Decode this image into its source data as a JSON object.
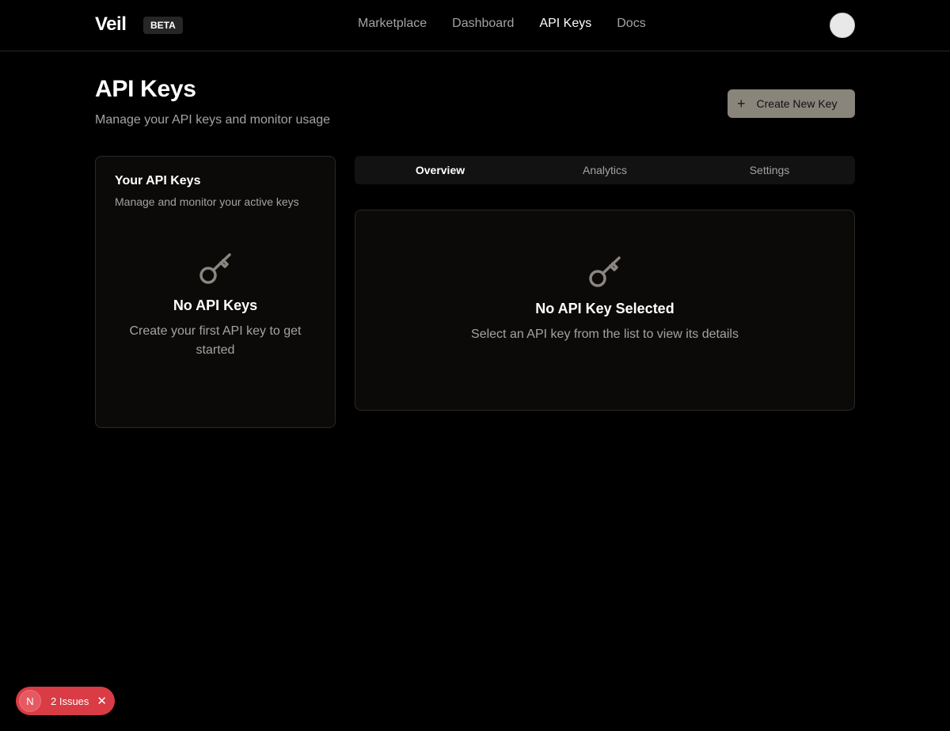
{
  "header": {
    "logo": "Veil",
    "badge": "BETA",
    "nav": [
      {
        "label": "Marketplace"
      },
      {
        "label": "Dashboard"
      },
      {
        "label": "API Keys"
      },
      {
        "label": "Docs"
      }
    ],
    "active_nav": "API Keys"
  },
  "page": {
    "title": "API Keys",
    "subtitle": "Manage your API keys and monitor usage",
    "create_button": "Create New Key",
    "create_icon": "plus-icon"
  },
  "keys_panel": {
    "title": "Your API Keys",
    "subtitle": "Manage and monitor your active keys",
    "empty_icon": "key-icon",
    "empty_title": "No API Keys",
    "empty_text": "Create your first API key to get started"
  },
  "tabs": [
    {
      "label": "Overview"
    },
    {
      "label": "Analytics"
    },
    {
      "label": "Settings"
    }
  ],
  "active_tab": "Overview",
  "detail": {
    "empty_icon": "key-icon",
    "empty_title": "No API Key Selected",
    "empty_text": "Select an API key from the list to view its details"
  },
  "issues_badge": {
    "icon_letter": "N",
    "label": "2 Issues"
  },
  "colors": {
    "background": "#000000",
    "accent_button": "#8a857b",
    "issues_red": "#d93c44"
  }
}
